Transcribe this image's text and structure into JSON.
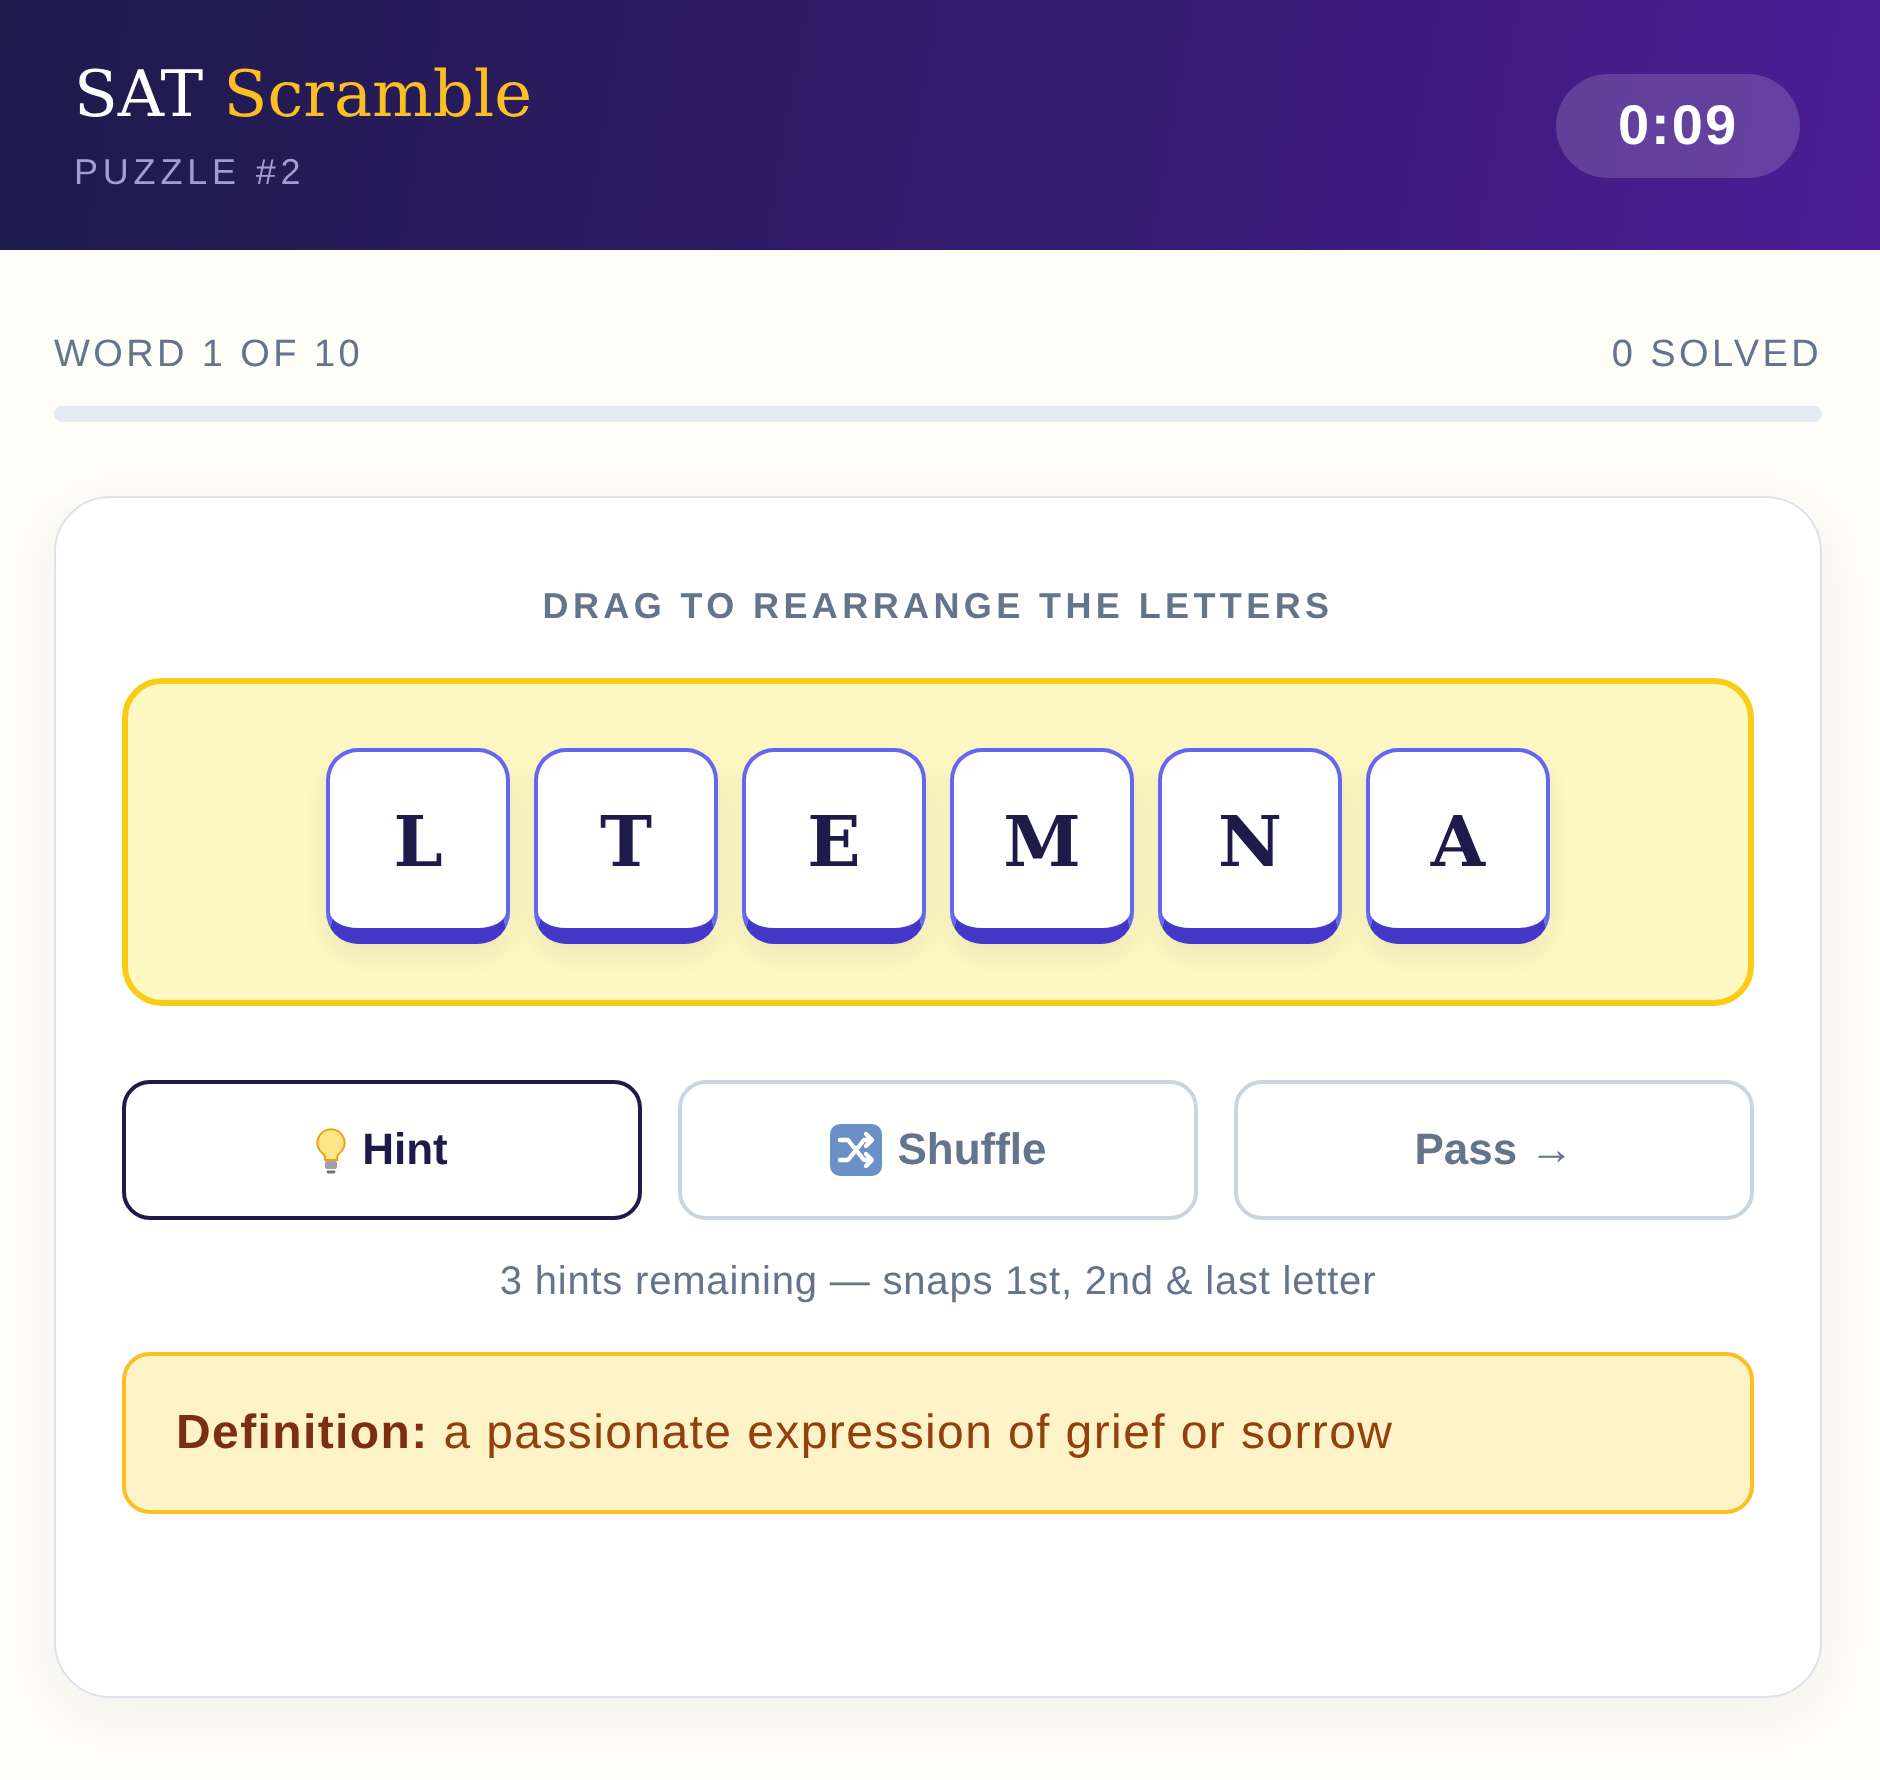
{
  "header": {
    "title": "SAT",
    "title_accent": "Scramble",
    "subtitle": "PUZZLE #2",
    "timer": "0:09"
  },
  "progress": {
    "word_label": "WORD 1 OF 10",
    "solved_label": "0 SOLVED",
    "level": 0
  },
  "puzzle": {
    "instruction": "DRAG TO REARRANGE THE LETTERS",
    "tiles": [
      "L",
      "T",
      "E",
      "M",
      "N",
      "A"
    ],
    "buttons": [
      {
        "label": "Hint",
        "kind": "hint"
      },
      {
        "label": "Shuffle",
        "kind": "shuffle"
      },
      {
        "label": "Pass →",
        "kind": "pass"
      }
    ],
    "hint_note": "3 hints remaining — snaps 1st, 2nd & last letter",
    "definition": "**Definition:** a passionate expression of grief or sorrow"
  }
}
